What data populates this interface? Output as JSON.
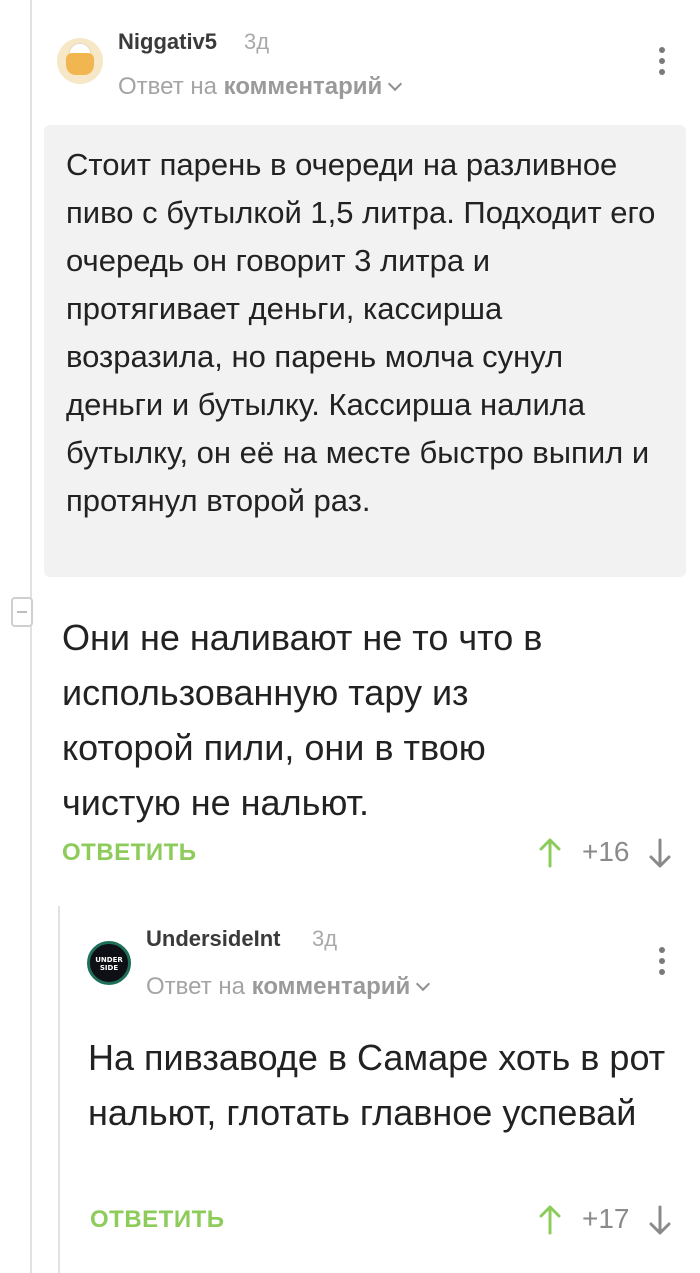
{
  "comment1": {
    "author": "Niggativ5",
    "time": "3д",
    "reply_prefix": "Ответ на",
    "reply_link": "комментарий",
    "quote": "Стоит парень в очереди на разливное пиво с бутылкой 1,5 литра. Подходит его очередь он говорит 3 литра и протягивает деньги, кассирша возразила, но парень молча сунул деньги и бутылку. Кассирша налила бутылку, он её на месте быстро выпил и протянул второй раз.",
    "text": "Они не наливают не то что в использованную тару из которой пили, они в твою чистую не нальют.",
    "reply_label": "ОТВЕТИТЬ",
    "score": "+16"
  },
  "comment2": {
    "author": "UndersideInt",
    "time": "3д",
    "reply_prefix": "Ответ на",
    "reply_link": "комментарий",
    "avatar_text": "UNDER SIDE",
    "text": "На пивзаводе в Самаре хоть в рот нальют, глотать главное успевай",
    "reply_label": "ОТВЕТИТЬ",
    "score": "+17"
  },
  "colors": {
    "accent_green": "#8dcc5b",
    "quote_bg": "#f2f2f2",
    "muted": "#a4a4a4"
  },
  "icons": [
    "more-vert-icon",
    "arrow-up-icon",
    "arrow-down-icon",
    "collapse-minus-icon",
    "chevron-down-icon"
  ]
}
